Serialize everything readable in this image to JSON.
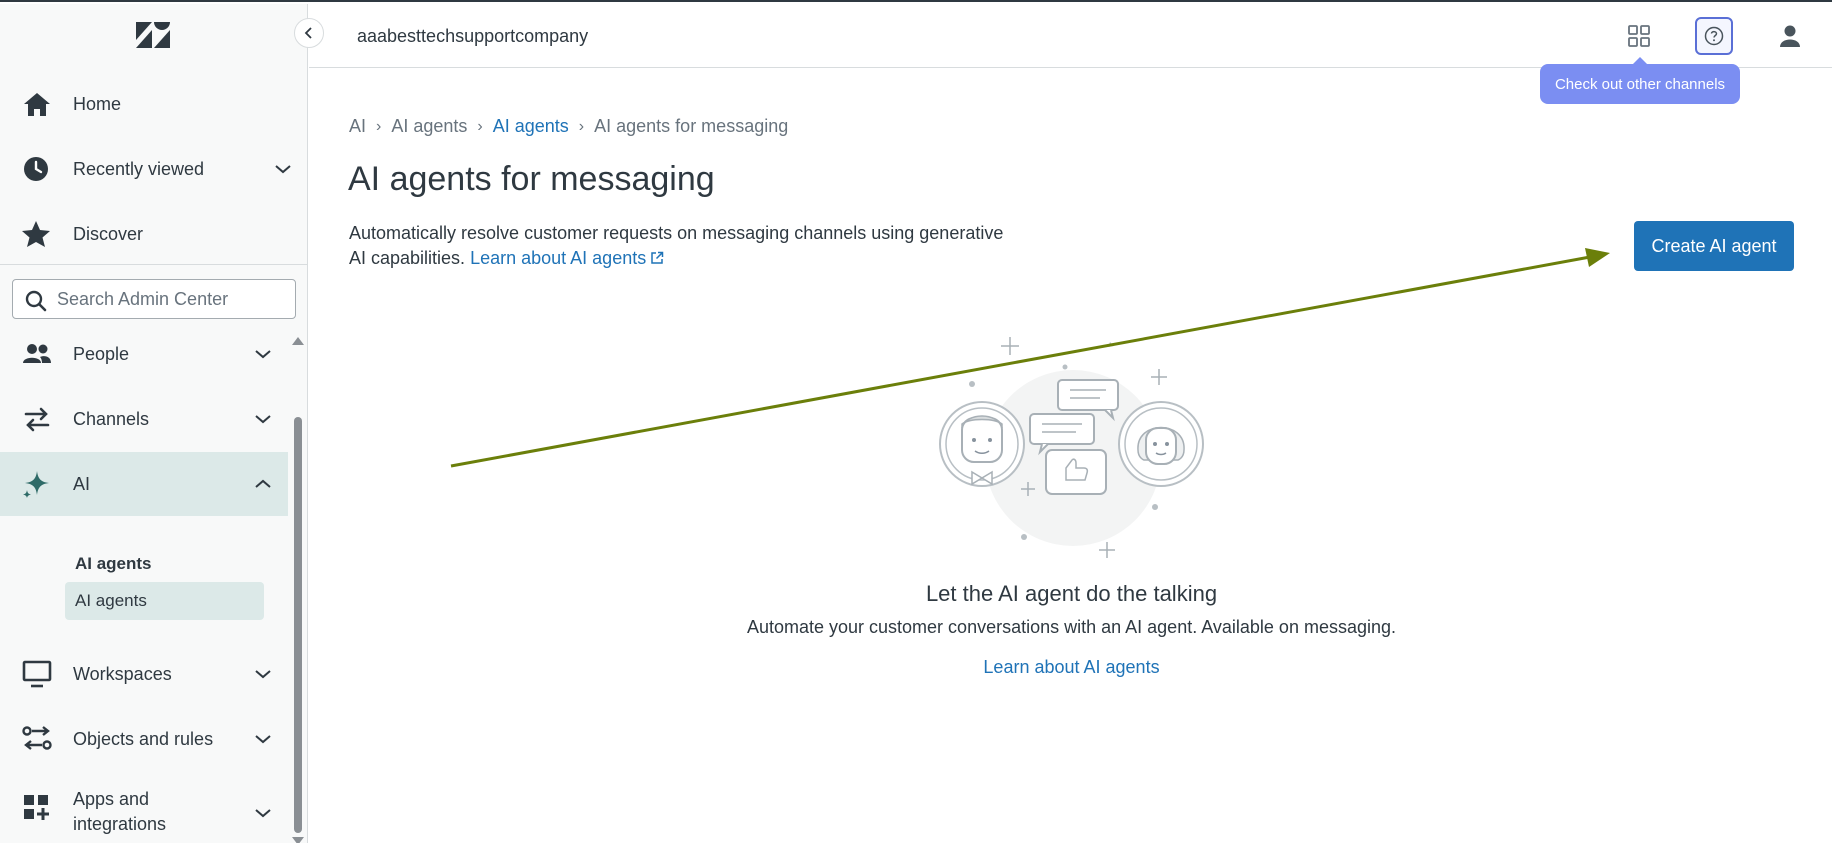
{
  "sidebar": {
    "nav_top": [
      {
        "label": "Home",
        "icon": "home-icon"
      },
      {
        "label": "Recently viewed",
        "icon": "clock-icon"
      },
      {
        "label": "Discover",
        "icon": "star-icon"
      }
    ],
    "search": {
      "placeholder": "Search Admin Center"
    },
    "nav_main": [
      {
        "label": "People",
        "icon": "people-icon"
      },
      {
        "label": "Channels",
        "icon": "channels-icon"
      },
      {
        "label": "AI",
        "icon": "sparkle-icon",
        "expanded": true
      },
      {
        "label": "Workspaces",
        "icon": "monitor-icon"
      },
      {
        "label": "Objects and rules",
        "icon": "objects-icon"
      },
      {
        "label": "Apps and integrations",
        "label_line1": "Apps and",
        "label_line2": "integrations",
        "icon": "apps-icon"
      }
    ],
    "ai_section": {
      "heading": "AI agents",
      "item": "AI agents"
    }
  },
  "header": {
    "company": "aaabesttechsupportcompany",
    "tooltip": "Check out other channels"
  },
  "breadcrumb": [
    "AI",
    "AI agents",
    "AI agents",
    "AI agents for messaging"
  ],
  "page": {
    "title": "AI agents for messaging",
    "description": "Automatically resolve customer requests on messaging channels using generative AI capabilities.",
    "description_link": "Learn about AI agents",
    "create_button": "Create AI agent",
    "empty_state": {
      "title": "Let the AI agent do the talking",
      "description": "Automate your customer conversations with an AI agent. Available on messaging.",
      "link": "Learn about AI agents"
    }
  },
  "colors": {
    "brand_blue": "#1f73b7",
    "active_nav_bg": "#dce9e8",
    "tooltip_bg": "#7b8ef2",
    "annotation_arrow": "#6b7f0a"
  }
}
